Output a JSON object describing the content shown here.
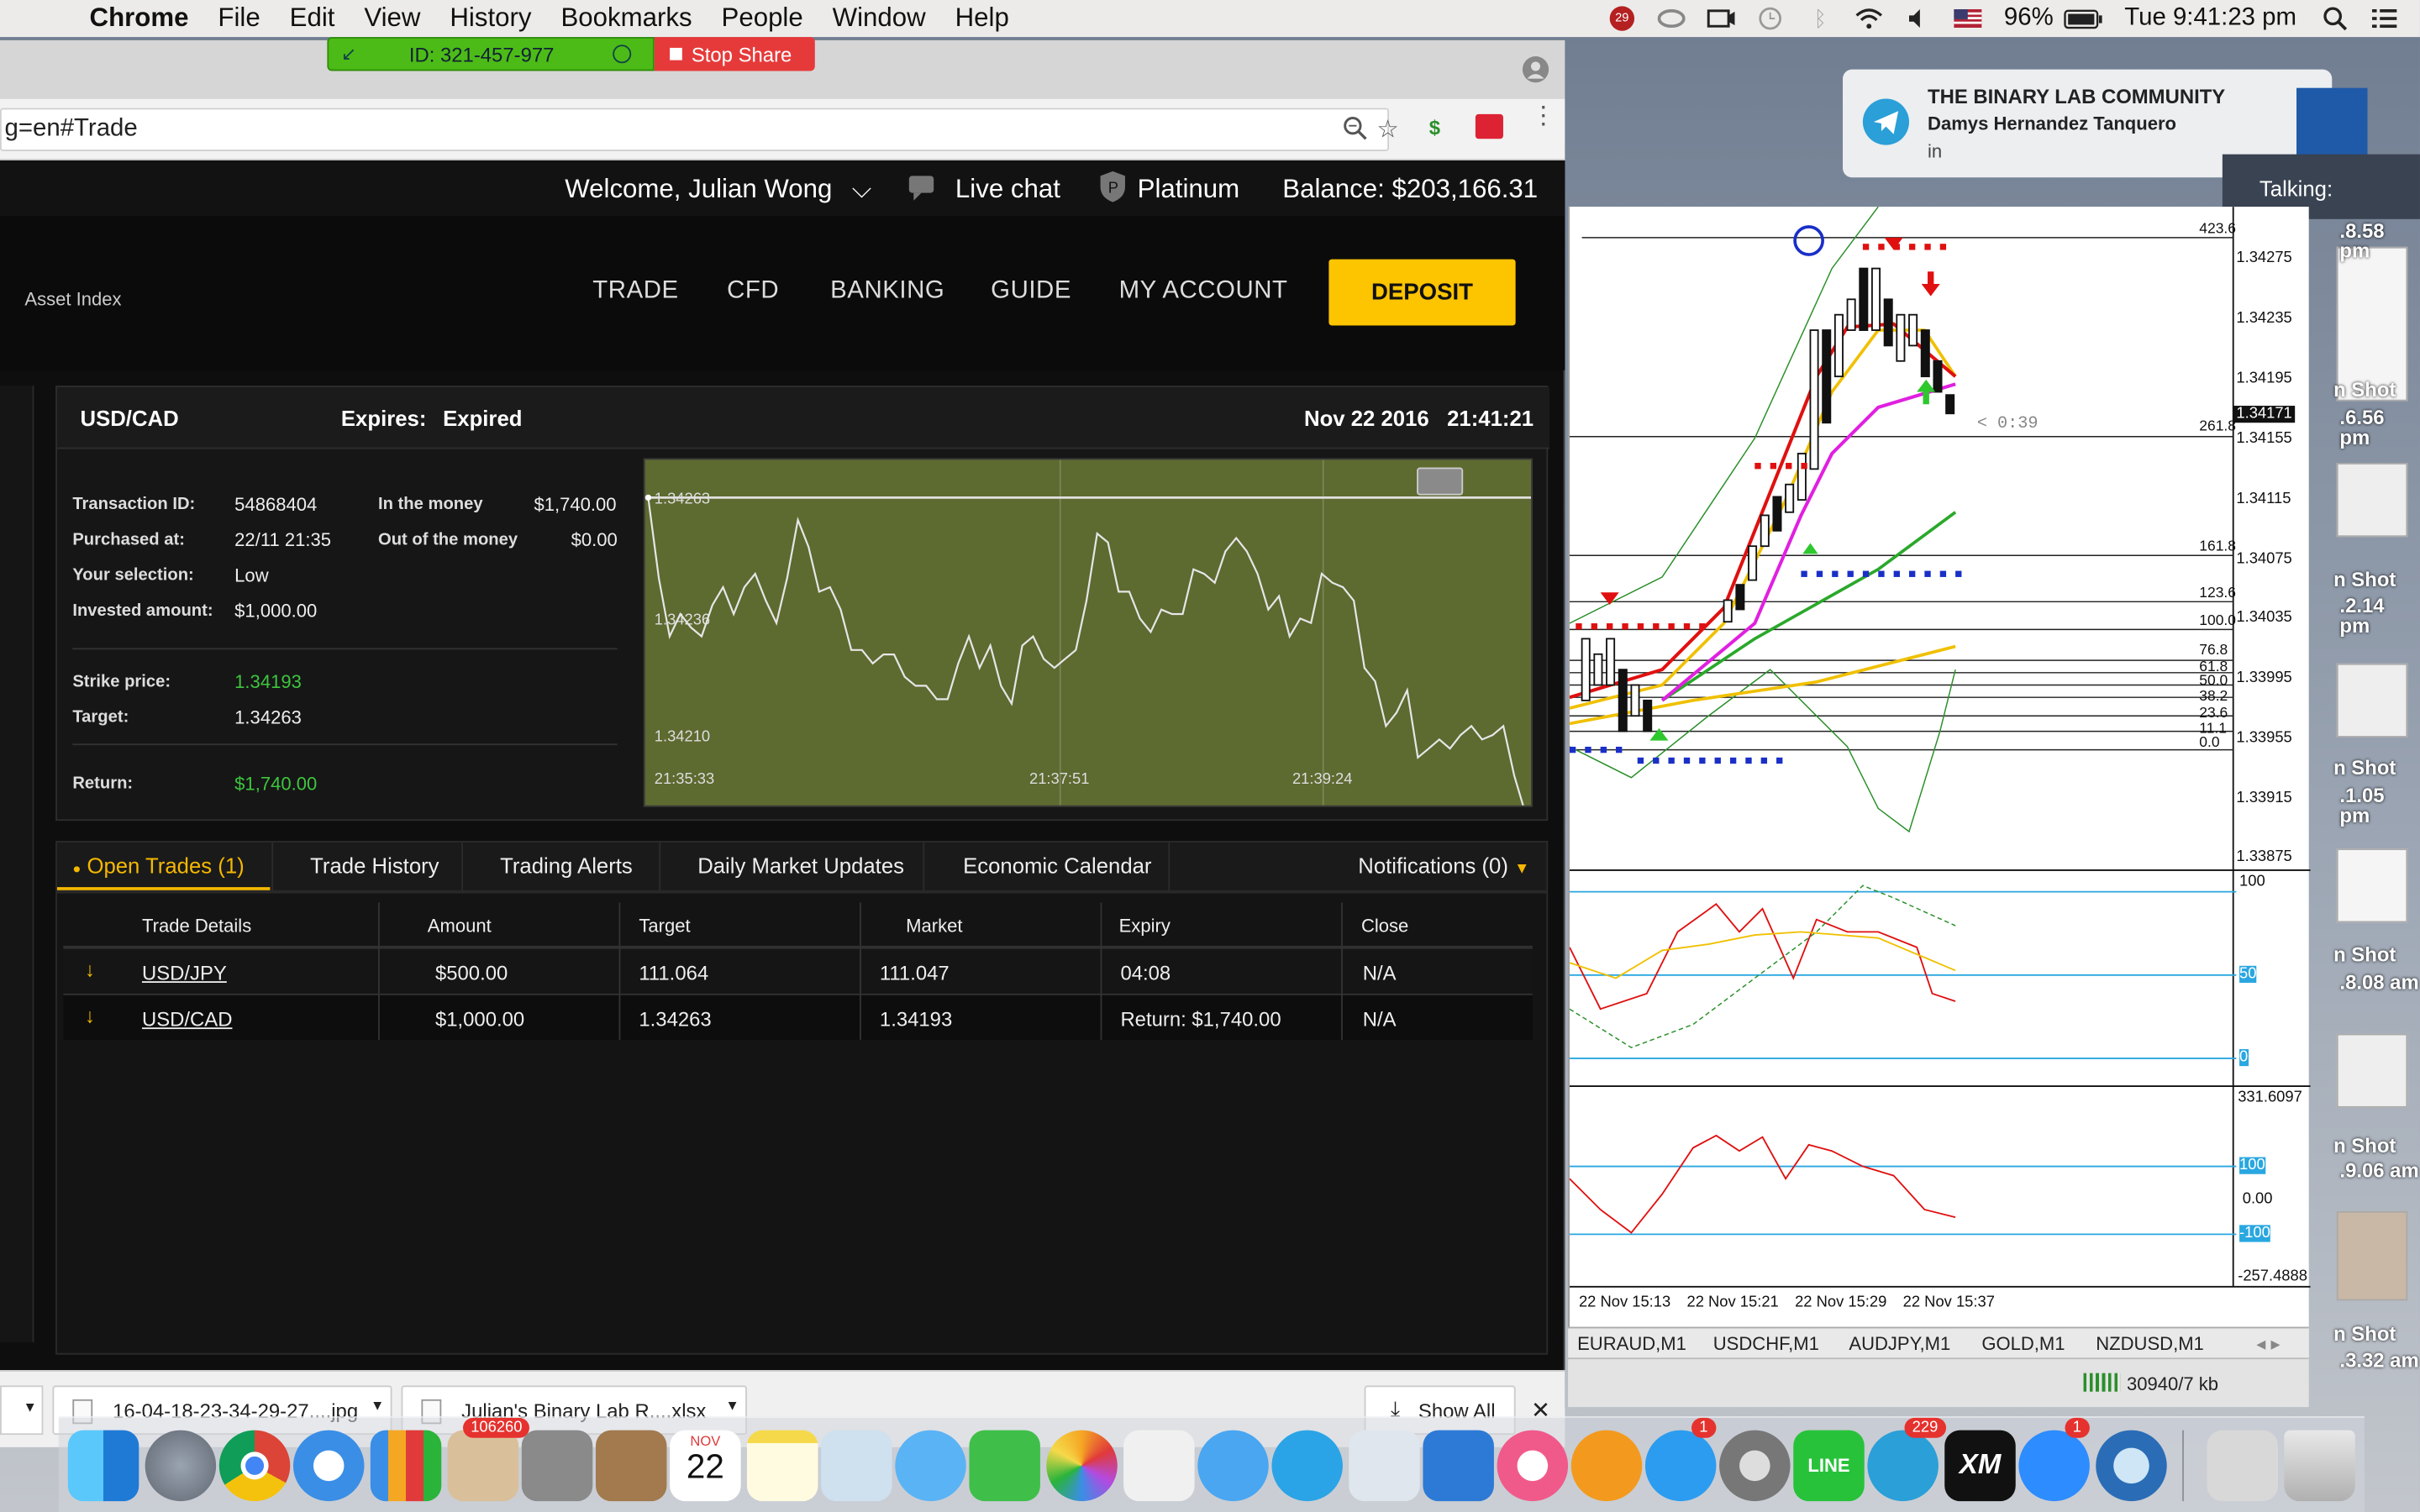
{
  "menubar": {
    "app_name": "Chrome",
    "menus": [
      "File",
      "Edit",
      "View",
      "History",
      "Bookmarks",
      "People",
      "Window",
      "Help"
    ],
    "battery_percent": "96%",
    "clock": "Tue 9:41:23 pm",
    "badge_count": "29"
  },
  "screen_share": {
    "id_label": "ID: 321-457-977",
    "stop_label": "Stop Share"
  },
  "address_bar": {
    "url": "g=en#Trade"
  },
  "site": {
    "welcome": "Welcome, Julian Wong",
    "live_chat": "Live chat",
    "tier": "Platinum",
    "balance": "Balance: $203,166.31",
    "asset_index": "Asset Index",
    "nav": [
      "TRADE",
      "CFD",
      "BANKING",
      "GUIDE",
      "MY ACCOUNT"
    ],
    "deposit": "DEPOSIT"
  },
  "trade_panel": {
    "pair": "USD/CAD",
    "expires_label": "Expires:",
    "expires_value": "Expired",
    "datetime": "Nov 22 2016   21:41:21",
    "fields": {
      "transaction_id_label": "Transaction ID:",
      "transaction_id": "54868404",
      "purchased_label": "Purchased at:",
      "purchased": "22/11 21:35",
      "selection_label": "Your selection:",
      "selection": "Low",
      "invested_label": "Invested amount:",
      "invested": "$1,000.00",
      "in_money_label": "In the money",
      "in_money": "$1,740.00",
      "out_money_label": "Out of the money",
      "out_money": "$0.00",
      "strike_label": "Strike price:",
      "strike": "1.34193",
      "target_label": "Target:",
      "target": "1.34263",
      "return_label": "Return:",
      "return": "$1,740.00"
    }
  },
  "chart_data": {
    "type": "line",
    "x_ticks": [
      "21:35:33",
      "21:37:51",
      "21:39:24"
    ],
    "y_ticks": [
      "1.34263",
      "1.34236",
      "1.34210"
    ],
    "ylim": [
      1.34195,
      1.34268
    ],
    "values": [
      1.34263,
      1.34245,
      1.34232,
      1.34237,
      1.34234,
      1.34232,
      1.34239,
      1.34243,
      1.34237,
      1.34243,
      1.34246,
      1.3424,
      1.34235,
      1.34245,
      1.34258,
      1.34252,
      1.34242,
      1.34243,
      1.34238,
      1.34229,
      1.34229,
      1.34226,
      1.34228,
      1.34228,
      1.34223,
      1.34221,
      1.34221,
      1.34218,
      1.34218,
      1.34226,
      1.34232,
      1.34225,
      1.3423,
      1.34221,
      1.34217,
      1.3423,
      1.34232,
      1.34227,
      1.34225,
      1.34227,
      1.34229,
      1.3424,
      1.34255,
      1.34253,
      1.34242,
      1.34242,
      1.34236,
      1.34233,
      1.34238,
      1.34237,
      1.34237,
      1.34247,
      1.34246,
      1.34244,
      1.34251,
      1.34254,
      1.34251,
      1.34246,
      1.34238,
      1.34241,
      1.34232,
      1.34236,
      1.34235,
      1.34246,
      1.34244,
      1.34243,
      1.3424,
      1.34225,
      1.34222,
      1.34212,
      1.34215,
      1.3422,
      1.34205,
      1.34207,
      1.34209,
      1.34207,
      1.3421,
      1.34212,
      1.34209,
      1.3421,
      1.34212,
      1.34201,
      1.34193
    ],
    "title": "",
    "xlabel": "",
    "ylabel": ""
  },
  "tabs": {
    "open_trades": "Open Trades (1)",
    "history": "Trade History",
    "alerts": "Trading Alerts",
    "updates": "Daily Market Updates",
    "calendar": "Economic Calendar",
    "notifications": "Notifications (0)"
  },
  "trades_table": {
    "headers": [
      "Trade Details",
      "Amount",
      "Target",
      "Market",
      "Expiry",
      "Close"
    ],
    "rows": [
      {
        "pair": "USD/JPY",
        "amount": "$500.00",
        "target": "111.064",
        "market": "111.047",
        "expiry": "04:08",
        "close": "N/A"
      },
      {
        "pair": "USD/CAD",
        "amount": "$1,000.00",
        "target": "1.34263",
        "market": "1.34193",
        "expiry": "Return: $1,740.00",
        "close": "N/A"
      }
    ]
  },
  "downloads": {
    "file1": "16-04-18-23-34-29-27....jpg",
    "file2": "Julian's Binary Lab R....xlsx",
    "show_all": "Show All"
  },
  "notification": {
    "title": "THE BINARY LAB COMMUNITY",
    "sender": "Damys Hernandez Tanquero",
    "body": "in"
  },
  "talking": "Talking:",
  "mt4": {
    "price_scale": [
      "1.34275",
      "1.34235",
      "1.34195",
      "1.34171",
      "1.34155",
      "1.34115",
      "1.34075",
      "1.34035",
      "1.33995",
      "1.33955",
      "1.33915",
      "1.33875"
    ],
    "fib_levels": [
      "423.6",
      "261.8",
      "161.8",
      "123.6",
      "100.0",
      "76.8",
      "61.8",
      "50.0",
      "38.2",
      "23.6",
      "11.1",
      "0.0"
    ],
    "countdown": "< 0:39",
    "osc1_levels": [
      "100",
      "50",
      "0"
    ],
    "osc2_values": [
      "331.6097",
      "100",
      "0.00",
      "-100",
      "-257.4888"
    ],
    "time_axis": [
      "22 Nov 15:13",
      "22 Nov 15:21",
      "22 Nov 15:29",
      "22 Nov 15:37"
    ],
    "symbol_tabs": [
      "EURAUD,M1",
      "USDCHF,M1",
      "AUDJPY,M1",
      "GOLD,M1",
      "NZDUSD,M1"
    ],
    "status": "30940/7 kb"
  },
  "desktop_thumbs": [
    {
      "line1": "Shot",
      "line2": ".8.58 pm"
    },
    {
      "line1": "n Shot",
      "line2": ".6.56 pm"
    },
    {
      "line1": "n Shot",
      "line2": ".2.14 pm"
    },
    {
      "line1": "n Shot",
      "line2": ".1.05 pm"
    },
    {
      "line1": "n Shot",
      "line2": ".8.08 am"
    },
    {
      "line1": "n Shot",
      "line2": ".9.06 am"
    },
    {
      "line1": "n Shot",
      "line2": ".3.32 am"
    }
  ],
  "dock": {
    "badge_mail": "106260",
    "calendar_month": "NOV",
    "calendar_day": "22",
    "badge_appstore": "1",
    "badge_telegram": "229",
    "badge_zoom": "1",
    "line_label": "LINE",
    "xm_label": "XM"
  }
}
